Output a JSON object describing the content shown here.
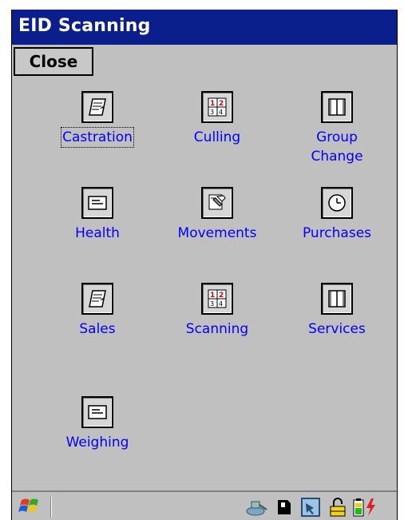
{
  "window": {
    "title": "EID Scanning"
  },
  "toolbar": {
    "close_label": "Close"
  },
  "menu": {
    "items": [
      {
        "label": "Castration",
        "icon": "notepad-icon"
      },
      {
        "label": "Culling",
        "icon": "numbers-grid-icon"
      },
      {
        "label": "Group Change",
        "icon": "book-icon"
      },
      {
        "label": "Health",
        "icon": "card-icon"
      },
      {
        "label": "Movements",
        "icon": "pliers-icon"
      },
      {
        "label": "Purchases",
        "icon": "clock-icon"
      },
      {
        "label": "Sales",
        "icon": "notepad-icon"
      },
      {
        "label": "Scanning",
        "icon": "numbers-grid-icon"
      },
      {
        "label": "Services",
        "icon": "book-icon"
      },
      {
        "label": "Weighing",
        "icon": "card-icon"
      }
    ]
  },
  "taskbar": {
    "start_icon": "windows-flag-icon",
    "tray_icons": [
      "network-icon",
      "sd-card-icon",
      "app-icon",
      "lock-icon",
      "battery-charging-icon"
    ]
  },
  "colors": {
    "titlebar": "#0b1f8c",
    "link": "#0000ff",
    "background": "#c0c0c0"
  }
}
